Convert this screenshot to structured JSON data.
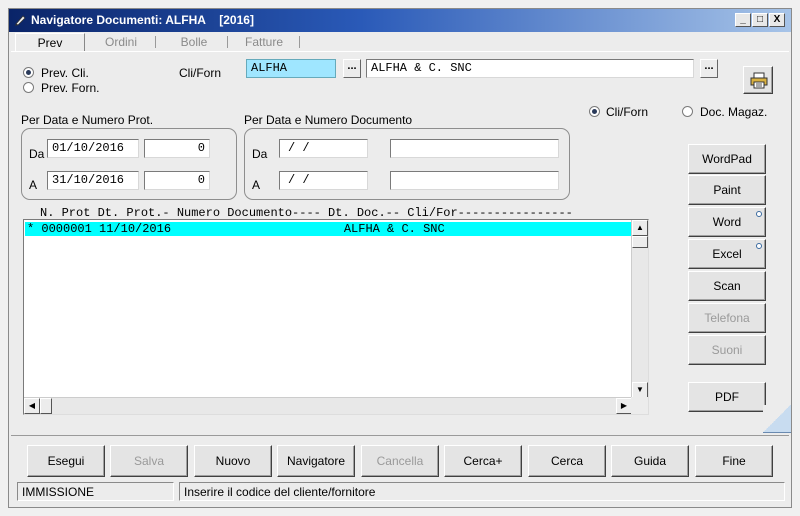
{
  "window": {
    "title": "Navigatore Documenti: ALFHA",
    "year": "[2016]",
    "controls": {
      "minimize": "_",
      "maximize": "□",
      "close": "X"
    }
  },
  "tabs": [
    {
      "label": "Prev",
      "active": true
    },
    {
      "label": "Ordini",
      "active": false
    },
    {
      "label": "Bolle",
      "active": false
    },
    {
      "label": "Fatture",
      "active": false
    }
  ],
  "tab_separator": "|",
  "prev_type": {
    "options": [
      {
        "label": "Prev. Cli.",
        "selected": true
      },
      {
        "label": "Prev. Forn.",
        "selected": false
      }
    ]
  },
  "clifor": {
    "label": "Cli/Forn",
    "code": "ALFHA",
    "name": "ALFHA & C. SNC",
    "lookup_label": "..."
  },
  "filter_mode": {
    "options": [
      {
        "label": "Cli/Forn",
        "selected": true
      },
      {
        "label": "Doc. Magaz.",
        "selected": false
      }
    ]
  },
  "prot_group": {
    "title": "Per Data e Numero Prot.",
    "from_label": "Da",
    "from_date": "01/10/2016",
    "from_num": "0",
    "to_label": "A",
    "to_date": "31/10/2016",
    "to_num": "0"
  },
  "doc_group": {
    "title": "Per Data e Numero Documento",
    "from_label": "Da",
    "from_date": " /  /",
    "from_num": "",
    "to_label": "A",
    "to_date": " /  /",
    "to_num": ""
  },
  "list": {
    "header": "N. Prot Dt. Prot.- Numero Documento---- Dt. Doc.-- Cli/For----------------",
    "rows": [
      {
        "text": "* 0000001 11/10/2016                        ALFHA & C. SNC",
        "selected": true
      }
    ]
  },
  "side_buttons": [
    {
      "name": "wordpad-button",
      "label": "WordPad",
      "enabled": true,
      "dot": false
    },
    {
      "name": "paint-button",
      "label": "Paint",
      "enabled": true,
      "dot": false
    },
    {
      "name": "word-button",
      "label": "Word",
      "enabled": true,
      "dot": true
    },
    {
      "name": "excel-button",
      "label": "Excel",
      "enabled": true,
      "dot": true
    },
    {
      "name": "scan-button",
      "label": "Scan",
      "enabled": true,
      "dot": false
    },
    {
      "name": "telefona-button",
      "label": "Telefona",
      "enabled": false,
      "dot": false
    },
    {
      "name": "suoni-button",
      "label": "Suoni",
      "enabled": false,
      "dot": false
    }
  ],
  "pdf_button": "PDF",
  "bottom_buttons": [
    {
      "name": "esegui-button",
      "label": "Esegui",
      "enabled": true
    },
    {
      "name": "salva-button",
      "label": "Salva",
      "enabled": false
    },
    {
      "name": "nuovo-button",
      "label": "Nuovo",
      "enabled": true
    },
    {
      "name": "navigatore-button",
      "label": "Navigatore",
      "enabled": true
    },
    {
      "name": "cancella-button",
      "label": "Cancella",
      "enabled": false
    },
    {
      "name": "cerca-plus-button",
      "label": "Cerca+",
      "enabled": true
    },
    {
      "name": "cerca-button",
      "label": "Cerca",
      "enabled": true
    },
    {
      "name": "guida-button",
      "label": "Guida",
      "enabled": true
    },
    {
      "name": "fine-button",
      "label": "Fine",
      "enabled": true
    }
  ],
  "status": {
    "mode": "IMMISSIONE",
    "message": "Inserire il codice del cliente/fornitore"
  },
  "icons": {
    "title_icon": "pencil-icon",
    "print_icon": "printer-icon"
  }
}
